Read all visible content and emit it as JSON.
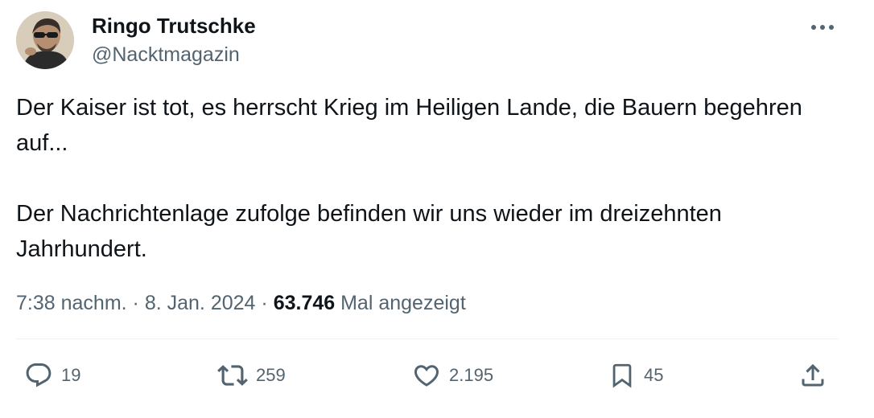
{
  "author": {
    "display_name": "Ringo Trutschke",
    "handle": "@Nacktmagazin",
    "avatar_icon": "user-avatar-photo"
  },
  "more_icon": "more-dots-icon",
  "tweet": {
    "paragraphs": [
      "Der Kaiser ist tot, es herrscht Krieg im Heiligen Lande, die Bauern begehren auf...",
      "Der Nachrichtenlage zufolge befinden wir uns wieder im dreizehnten Jahrhundert."
    ]
  },
  "meta": {
    "time": "7:38 nachm.",
    "sep1": "·",
    "date": "8. Jan. 2024",
    "sep2": "·",
    "views_count": "63.746",
    "views_label": "Mal angezeigt"
  },
  "actions": {
    "replies": {
      "icon": "reply-icon",
      "count": "19"
    },
    "reposts": {
      "icon": "repost-icon",
      "count": "259"
    },
    "likes": {
      "icon": "heart-icon",
      "count": "2.195"
    },
    "bookmarks": {
      "icon": "bookmark-icon",
      "count": "45"
    },
    "share": {
      "icon": "share-icon"
    }
  },
  "colors": {
    "text": "#0f1419",
    "secondary": "#536471",
    "divider": "#eff3f4"
  }
}
